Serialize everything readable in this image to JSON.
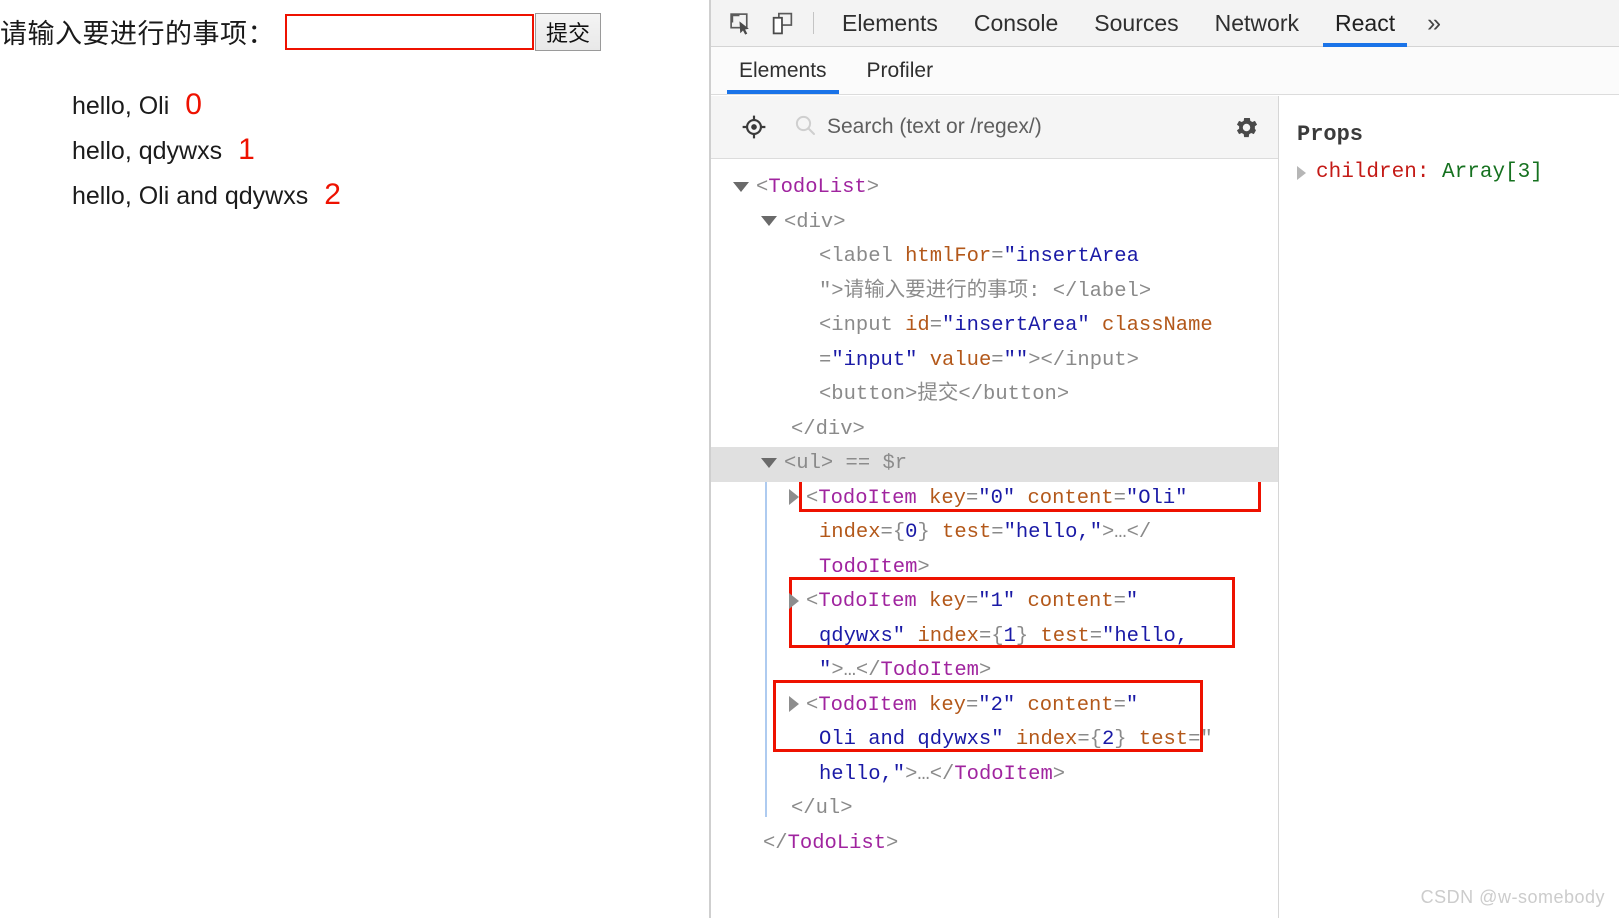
{
  "app_page": {
    "label": "请输入要进行的事项：",
    "input": {
      "value": "",
      "placeholder": ""
    },
    "submit_label": "提交",
    "todos": [
      {
        "text": "hello, Oli",
        "mark": "0"
      },
      {
        "text": "hello, qdywxs",
        "mark": "1"
      },
      {
        "text": "hello, Oli and qdywxs",
        "mark": "2"
      }
    ]
  },
  "devtools": {
    "toolbar": {
      "inspect_icon": "inspect-element-icon",
      "device_icon": "device-toolbar-icon",
      "tabs": [
        {
          "label": "Elements",
          "active": false
        },
        {
          "label": "Console",
          "active": false
        },
        {
          "label": "Sources",
          "active": false
        },
        {
          "label": "Network",
          "active": false
        },
        {
          "label": "React",
          "active": true
        }
      ],
      "overflow_label": "»"
    },
    "subtabs": [
      {
        "label": "Elements",
        "active": true
      },
      {
        "label": "Profiler",
        "active": false
      }
    ],
    "search": {
      "target_icon": "select-component-icon",
      "search_icon": "search-icon",
      "placeholder": "Search (text or /regex/)",
      "value": "",
      "settings_icon": "gear-icon"
    },
    "tree": {
      "lines": [
        {
          "id": "l1",
          "indent": 0,
          "arrow": "down",
          "parts": [
            {
              "t": "<",
              "c": "tag"
            },
            {
              "t": "TodoList",
              "c": "comp"
            },
            {
              "t": ">",
              "c": "tag"
            }
          ]
        },
        {
          "id": "l2",
          "indent": 1,
          "arrow": "down",
          "parts": [
            {
              "t": "<div>",
              "c": "tag"
            }
          ]
        },
        {
          "id": "l3",
          "indent": 2,
          "arrow": "none",
          "parts": [
            {
              "t": "<label ",
              "c": "tag"
            },
            {
              "t": "htmlFor",
              "c": "attr"
            },
            {
              "t": "=",
              "c": "tag"
            },
            {
              "t": "\"insertArea",
              "c": "val"
            }
          ]
        },
        {
          "id": "l4",
          "indent": 2,
          "arrow": "none",
          "parts": [
            {
              "t": "\">",
              "c": "tag"
            },
            {
              "t": "请输入要进行的事项: ",
              "c": "gray"
            },
            {
              "t": "</label>",
              "c": "tag"
            }
          ]
        },
        {
          "id": "l5",
          "indent": 2,
          "arrow": "none",
          "parts": [
            {
              "t": "<input ",
              "c": "tag"
            },
            {
              "t": "id",
              "c": "attr"
            },
            {
              "t": "=",
              "c": "tag"
            },
            {
              "t": "\"insertArea\"",
              "c": "val"
            },
            {
              "t": " ",
              "c": "tag"
            },
            {
              "t": "className",
              "c": "attr"
            }
          ]
        },
        {
          "id": "l6",
          "indent": 2,
          "arrow": "none",
          "parts": [
            {
              "t": "=",
              "c": "tag"
            },
            {
              "t": "\"input\"",
              "c": "val"
            },
            {
              "t": " ",
              "c": "tag"
            },
            {
              "t": "value",
              "c": "attr"
            },
            {
              "t": "=",
              "c": "tag"
            },
            {
              "t": "\"\"",
              "c": "val"
            },
            {
              "t": "></input>",
              "c": "tag"
            }
          ]
        },
        {
          "id": "l7",
          "indent": 2,
          "arrow": "none",
          "parts": [
            {
              "t": "<button>",
              "c": "tag"
            },
            {
              "t": "提交",
              "c": "gray"
            },
            {
              "t": "</button>",
              "c": "tag"
            }
          ]
        },
        {
          "id": "l8",
          "indent": 1,
          "arrow": "none",
          "parts": [
            {
              "t": "</div>",
              "c": "tag"
            }
          ]
        },
        {
          "id": "l9",
          "indent": 1,
          "arrow": "down",
          "selected": true,
          "parts": [
            {
              "t": "<ul>",
              "c": "tag"
            },
            {
              "t": " == ",
              "c": "gray"
            },
            {
              "t": "$r",
              "c": "gray"
            }
          ]
        },
        {
          "id": "l10",
          "indent": 2,
          "arrow": "right",
          "parts": [
            {
              "t": "<",
              "c": "tag"
            },
            {
              "t": "TodoItem",
              "c": "comp"
            },
            {
              "t": " ",
              "c": "tag"
            },
            {
              "t": "key",
              "c": "attr"
            },
            {
              "t": "=",
              "c": "tag"
            },
            {
              "t": "\"0\"",
              "c": "val"
            },
            {
              "t": " ",
              "c": "tag"
            },
            {
              "t": "content",
              "c": "attr"
            },
            {
              "t": "=",
              "c": "tag"
            },
            {
              "t": "\"Oli\"",
              "c": "val"
            }
          ]
        },
        {
          "id": "l11",
          "indent": 2,
          "arrow": "none",
          "parts": [
            {
              "t": "index",
              "c": "attr"
            },
            {
              "t": "={",
              "c": "tag"
            },
            {
              "t": "0",
              "c": "val"
            },
            {
              "t": "} ",
              "c": "tag"
            },
            {
              "t": "test",
              "c": "attr"
            },
            {
              "t": "=",
              "c": "tag"
            },
            {
              "t": "\"hello,\"",
              "c": "val"
            },
            {
              "t": ">…</",
              "c": "tag"
            }
          ]
        },
        {
          "id": "l12",
          "indent": 2,
          "arrow": "none",
          "parts": [
            {
              "t": "TodoItem",
              "c": "comp"
            },
            {
              "t": ">",
              "c": "tag"
            }
          ]
        },
        {
          "id": "l13",
          "indent": 2,
          "arrow": "right",
          "parts": [
            {
              "t": "<",
              "c": "tag"
            },
            {
              "t": "TodoItem",
              "c": "comp"
            },
            {
              "t": " ",
              "c": "tag"
            },
            {
              "t": "key",
              "c": "attr"
            },
            {
              "t": "=",
              "c": "tag"
            },
            {
              "t": "\"1\"",
              "c": "val"
            },
            {
              "t": " ",
              "c": "tag"
            },
            {
              "t": "content",
              "c": "attr"
            },
            {
              "t": "=",
              "c": "tag"
            },
            {
              "t": "\"",
              "c": "val"
            }
          ]
        },
        {
          "id": "l14",
          "indent": 2,
          "arrow": "none",
          "parts": [
            {
              "t": "qdywxs\"",
              "c": "val"
            },
            {
              "t": " ",
              "c": "tag"
            },
            {
              "t": "index",
              "c": "attr"
            },
            {
              "t": "={",
              "c": "tag"
            },
            {
              "t": "1",
              "c": "val"
            },
            {
              "t": "} ",
              "c": "tag"
            },
            {
              "t": "test",
              "c": "attr"
            },
            {
              "t": "=",
              "c": "tag"
            },
            {
              "t": "\"hello,",
              "c": "val"
            }
          ]
        },
        {
          "id": "l15",
          "indent": 2,
          "arrow": "none",
          "parts": [
            {
              "t": "\"",
              "c": "val"
            },
            {
              "t": ">…</",
              "c": "tag"
            },
            {
              "t": "TodoItem",
              "c": "comp"
            },
            {
              "t": ">",
              "c": "tag"
            }
          ]
        },
        {
          "id": "l16",
          "indent": 2,
          "arrow": "right",
          "parts": [
            {
              "t": "<",
              "c": "tag"
            },
            {
              "t": "TodoItem",
              "c": "comp"
            },
            {
              "t": " ",
              "c": "tag"
            },
            {
              "t": "key",
              "c": "attr"
            },
            {
              "t": "=",
              "c": "tag"
            },
            {
              "t": "\"2\"",
              "c": "val"
            },
            {
              "t": " ",
              "c": "tag"
            },
            {
              "t": "content",
              "c": "attr"
            },
            {
              "t": "=",
              "c": "tag"
            },
            {
              "t": "\"",
              "c": "val"
            }
          ]
        },
        {
          "id": "l17",
          "indent": 2,
          "arrow": "none",
          "parts": [
            {
              "t": "Oli and qdywxs\"",
              "c": "val"
            },
            {
              "t": " ",
              "c": "tag"
            },
            {
              "t": "index",
              "c": "attr"
            },
            {
              "t": "={",
              "c": "tag"
            },
            {
              "t": "2",
              "c": "val"
            },
            {
              "t": "} ",
              "c": "tag"
            },
            {
              "t": "test",
              "c": "attr"
            },
            {
              "t": "=\"",
              "c": "tag"
            }
          ]
        },
        {
          "id": "l18",
          "indent": 2,
          "arrow": "none",
          "parts": [
            {
              "t": "hello,\"",
              "c": "val"
            },
            {
              "t": ">…</",
              "c": "tag"
            },
            {
              "t": "TodoItem",
              "c": "comp"
            },
            {
              "t": ">",
              "c": "tag"
            }
          ]
        },
        {
          "id": "l19",
          "indent": 1,
          "arrow": "none",
          "parts": [
            {
              "t": "</ul>",
              "c": "tag"
            }
          ]
        },
        {
          "id": "l20",
          "indent": 0,
          "arrow": "none",
          "parts": [
            {
              "t": "</",
              "c": "tag"
            },
            {
              "t": "TodoList",
              "c": "comp"
            },
            {
              "t": ">",
              "c": "tag"
            }
          ]
        }
      ]
    },
    "props": {
      "title": "Props",
      "rows": [
        {
          "key": "children:",
          "value": "Array[3]"
        }
      ]
    }
  },
  "watermark": "CSDN @w-somebody",
  "colors": {
    "annotation_red": "#ee1100",
    "accent_blue": "#1a73e8",
    "component_purple": "#a0249f",
    "attribute_orange": "#b3581a",
    "value_blue": "#1a1aa6",
    "props_key_red": "#c41a16",
    "props_value_green": "#15711f"
  }
}
